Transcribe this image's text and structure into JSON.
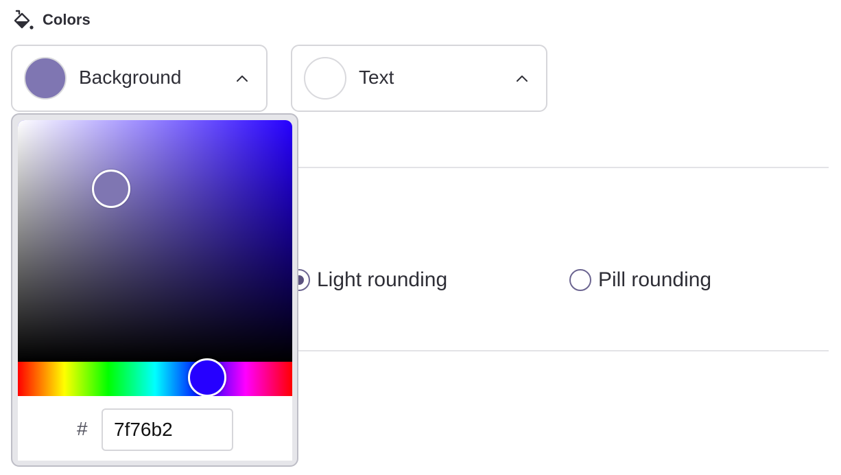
{
  "section": {
    "title": "Colors",
    "icon": "paint-bucket-icon"
  },
  "background_select": {
    "label": "Background",
    "swatch_color": "#7f76b2",
    "chevron": "chevron-up-icon"
  },
  "text_select": {
    "label": "Text",
    "swatch_color": "#ffffff",
    "chevron": "chevron-up-icon"
  },
  "rounding": {
    "options": [
      {
        "label": "Light rounding",
        "selected": true
      },
      {
        "label": "Pill rounding",
        "selected": false
      }
    ]
  },
  "picker": {
    "hue_color": "#2600ff",
    "selected_color": "#7f76b2",
    "hash_label": "#",
    "hex_value": "7f76b2"
  }
}
